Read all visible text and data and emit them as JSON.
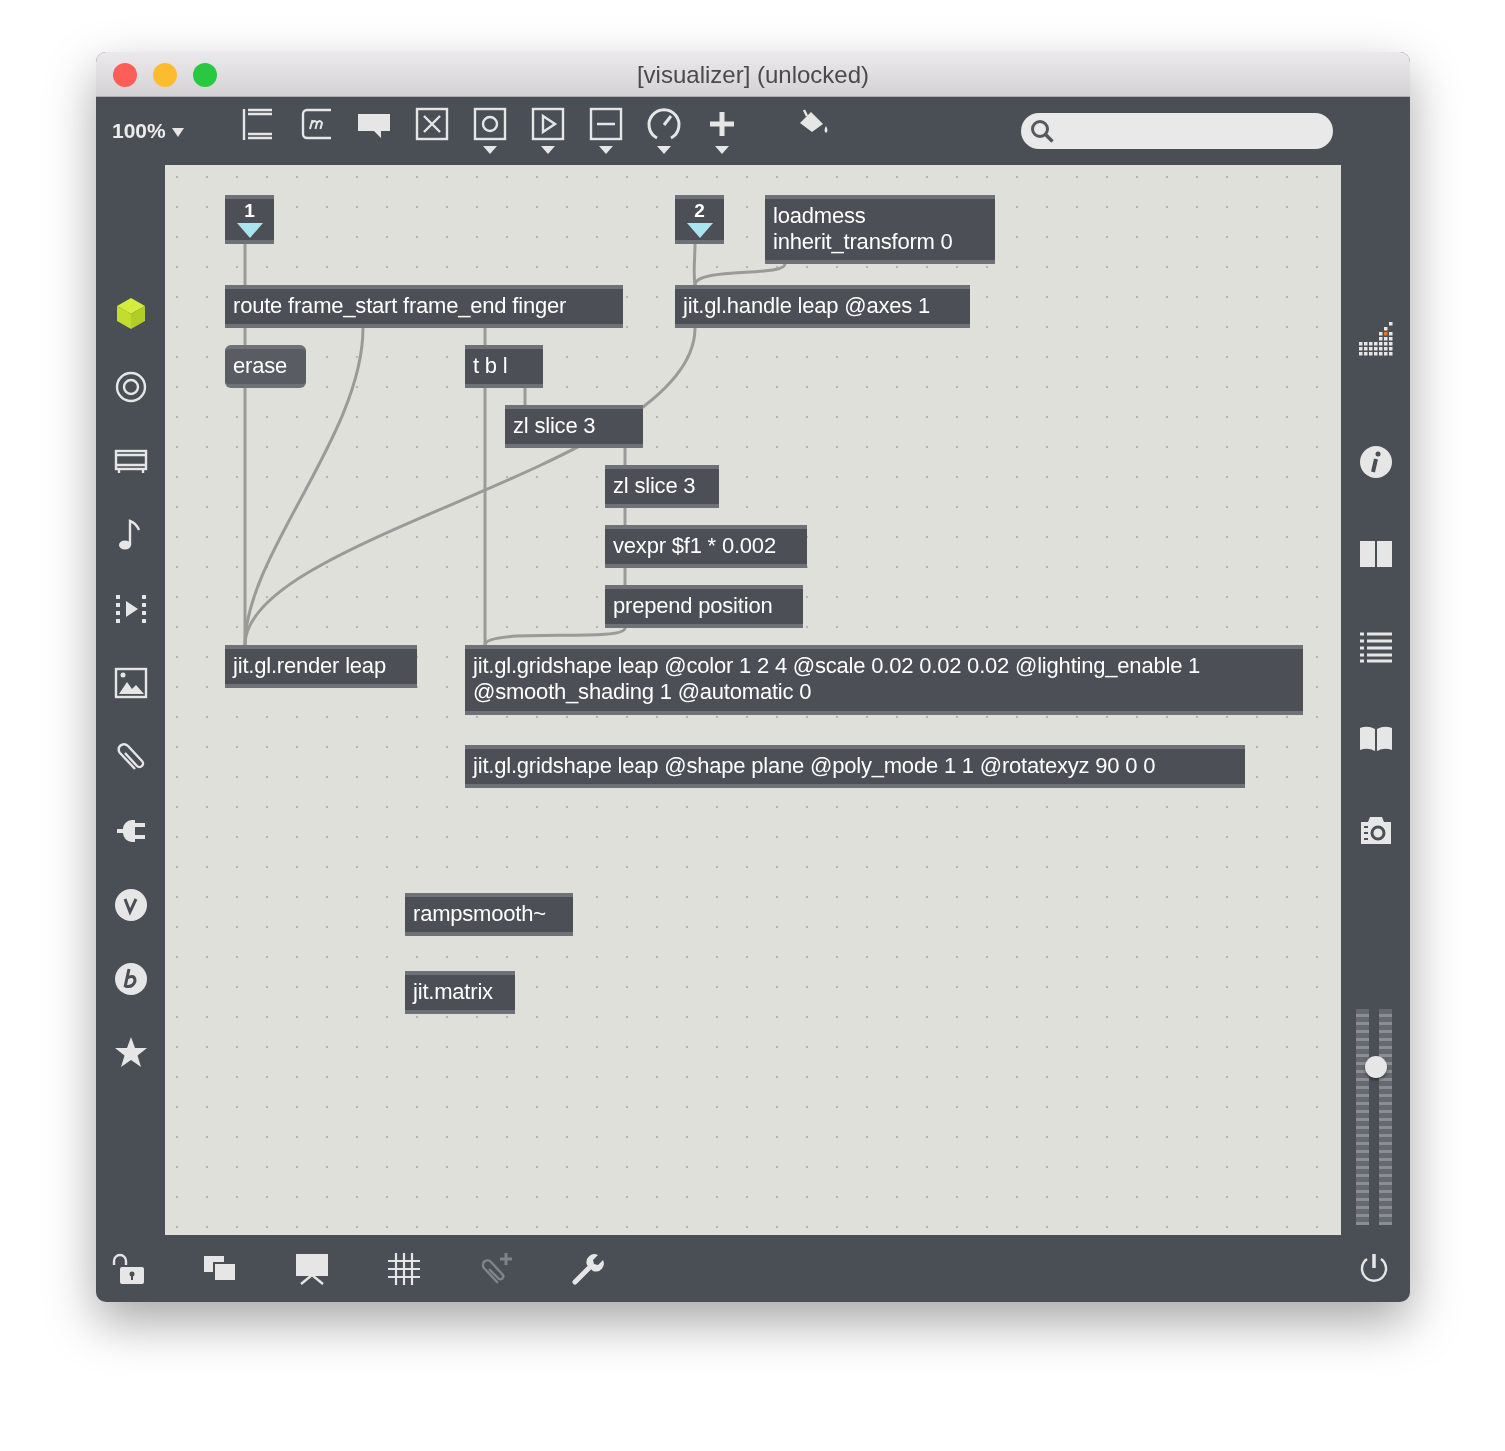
{
  "window": {
    "title": "[visualizer] (unlocked)"
  },
  "toolbar": {
    "zoom": "100%",
    "tools": [
      {
        "menu": false
      },
      {
        "menu": false
      },
      {
        "menu": false
      },
      {
        "menu": false
      },
      {
        "menu": true
      },
      {
        "menu": true
      },
      {
        "menu": true
      },
      {
        "menu": true
      },
      {
        "menu": true
      },
      {
        "menu": false
      }
    ]
  },
  "patcher": {
    "objects": [
      {
        "kind": "inlet",
        "text": "1"
      },
      {
        "kind": "inlet",
        "text": "2"
      },
      {
        "kind": "object",
        "text": "loadmess\ninherit_transform 0"
      },
      {
        "kind": "object",
        "text": "route frame_start frame_end finger"
      },
      {
        "kind": "object",
        "text": "jit.gl.handle leap @axes 1"
      },
      {
        "kind": "message",
        "text": "erase"
      },
      {
        "kind": "object",
        "text": "t b l"
      },
      {
        "kind": "object",
        "text": "zl slice 3"
      },
      {
        "kind": "object",
        "text": "zl slice 3"
      },
      {
        "kind": "object",
        "text": "vexpr $f1 * 0.002"
      },
      {
        "kind": "object",
        "text": "prepend position"
      },
      {
        "kind": "object",
        "text": "jit.gl.render leap"
      },
      {
        "kind": "object",
        "text": "jit.gl.gridshape leap @color 1 2 4 @scale 0.02 0.02 0.02 @lighting_enable 1\n@smooth_shading 1 @automatic 0"
      },
      {
        "kind": "object",
        "text": "jit.gl.gridshape leap @shape plane @poly_mode 1 1 @rotatexyz 90 0 0"
      },
      {
        "kind": "object",
        "text": "rampsmooth~"
      },
      {
        "kind": "object",
        "text": "jit.matrix"
      }
    ]
  },
  "right_sidebar": {
    "volume": {
      "level": 0.76
    }
  },
  "bottom_bar": {
    "tools": [
      {
        "disabled": false
      },
      {
        "disabled": false
      },
      {
        "disabled": false
      },
      {
        "disabled": false
      },
      {
        "disabled": true
      },
      {
        "disabled": false
      }
    ]
  }
}
